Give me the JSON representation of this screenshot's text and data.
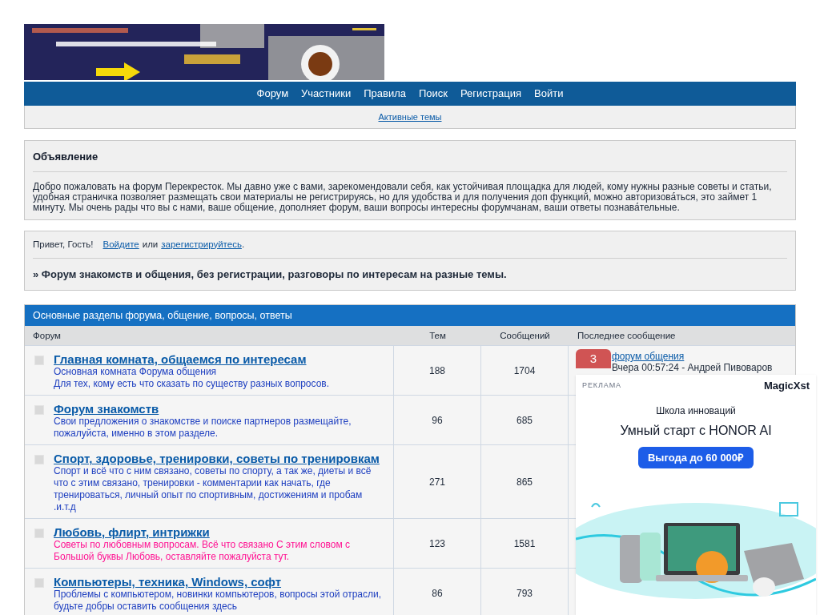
{
  "nav": {
    "items": [
      "Форум",
      "Участники",
      "Правила",
      "Поиск",
      "Регистрация",
      "Войти"
    ],
    "sub_link": "Активные темы"
  },
  "announcement": {
    "title": "Объявление",
    "text": "Добро пожаловать на форум Перекресток. Мы давно уже с вами, зарекомендовали себя, как устойчивая площадка для людей, кому нужны разные советы и статьи, удобная страничка позволяет размещать свои материалы не регистрируясь, но для удобства и для получения доп функций, можно авторизова́ться, это займет 1 минуту. Мы очень рады что вы с нами, ваше общение, дополняет форум, ваши вопросы интересны форумчанам, ваши ответы познава́тельные."
  },
  "welcome": {
    "greeting": "Привет, Гость!",
    "login": "Войдите",
    "or": "или",
    "register": "зарегистрируйтесь",
    "end": ".",
    "tagline": "» Форум знакомств и общения, без регистрации, разговоры по интересам на разные темы."
  },
  "category": {
    "title": "Основные разделы форума, общение, вопросы, ответы",
    "columns": [
      "Форум",
      "Тем",
      "Сообщений",
      "Последнее сообщение"
    ],
    "rows": [
      {
        "title": "Главная комната, общаемся по интересам",
        "desc": [
          "Основная комната Форума общения",
          "Для тех, кому есть что сказать по существу разных вопросов."
        ],
        "color": "#1e3fc0",
        "topics": "188",
        "posts": "1704",
        "last": [
          "форум общения",
          "Вчера 00:57:24 - Андрей Пивоваров"
        ]
      },
      {
        "title": "Форум знакомств",
        "desc": [
          "Свои предложения о знакомстве и поиске партнеров размещайте, пожалуйста, именно в этом разделе."
        ],
        "color": "#1e3fc0",
        "topics": "96",
        "posts": "685"
      },
      {
        "title": "Спорт, здоровье, тренировки, советы по тренировкам",
        "desc": [
          "Спорт и всё что с ним связано, советы по спорту, а так же, диеты и всё что с этим связано, тренировки - комментарии как начать, где тренироваться, личный опыт по спортивным, достижениям и пробам .и.т.д"
        ],
        "color": "#1e3fc0",
        "topics": "271",
        "posts": "865"
      },
      {
        "title": "Любовь, флирт, интрижки",
        "desc": [
          "Советы по любовным вопросам. Всё что связано С этим словом с Большой буквы Любовь, оставляйте пожалуйста тут."
        ],
        "color": "#ff1493",
        "topics": "123",
        "posts": "1581"
      },
      {
        "title": "Компьютеры, техника, Windows, софт",
        "desc": [
          "Проблемы с компьютером, новинки компьютеров, вопросы этой отрасли, будьте добры оставить сообщения здесь"
        ],
        "color": "#1e3fc0",
        "topics": "86",
        "posts": "793"
      }
    ]
  },
  "badge": "3",
  "ad": {
    "label": "РЕКЛАМА",
    "brand": "MagicXst",
    "subtitle": "Школа инноваций",
    "headline": "Умный старт с HONOR AI",
    "button": "Выгода до 60 000₽",
    "kind": "picture"
  }
}
